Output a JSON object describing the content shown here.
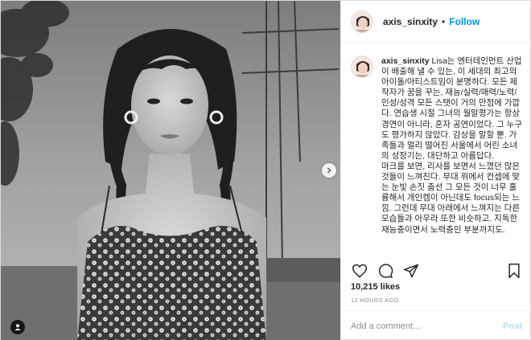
{
  "header": {
    "username": "axis_sinxity",
    "separator": "•",
    "follow_label": "Follow"
  },
  "caption": {
    "username": "axis_sinxity",
    "paragraph_1": "Lisa는 엔터테인먼트 산업이 배출해 낼 수 있는, 이 세대의 최고의 아이돌/아티스트임이 분명하다. 모든 제작자가 꿈을 꾸는, 재능/실력/매력/노력/인성/성격 모든 스탯이 거의 만점에 가깝다. 연습생 시절 그녀의 월말평가는 항상 경연이 아니라, 혼자 공연이었다. 그 누구도 평가하지 않았다. 감상을 말할 뿐. 가족들과 멀리 떨어진 서울에서 어린 소녀의 성장기는, 대단하고 아름답다.",
    "paragraph_2": "마크를 보면, 리사를 보면서 느꼈던 많은 것들이 느껴진다. 무대 위에서 컨셉에 맞는 눈빛 손짓 춤선 그 모든 것이 너무 훌륭해서 개인캠이 아닌데도 focus되는 느낌. 그런데 무대 아래에서 느껴지는 다른 모습들과 아우라 또한 비슷하고. 지독한 재능충이면서 노력충인 부분까지도."
  },
  "actions": {
    "icons": [
      "heart-icon",
      "comment-icon",
      "share-icon",
      "bookmark-icon"
    ]
  },
  "likes": "10,215 likes",
  "timestamp": "12 HOURS AGO",
  "comment": {
    "placeholder": "Add a comment…",
    "post_label": "Post"
  },
  "colors": {
    "accent": "#0095f6",
    "post_disabled": "#b2dffc",
    "muted": "#8e8e8e"
  }
}
